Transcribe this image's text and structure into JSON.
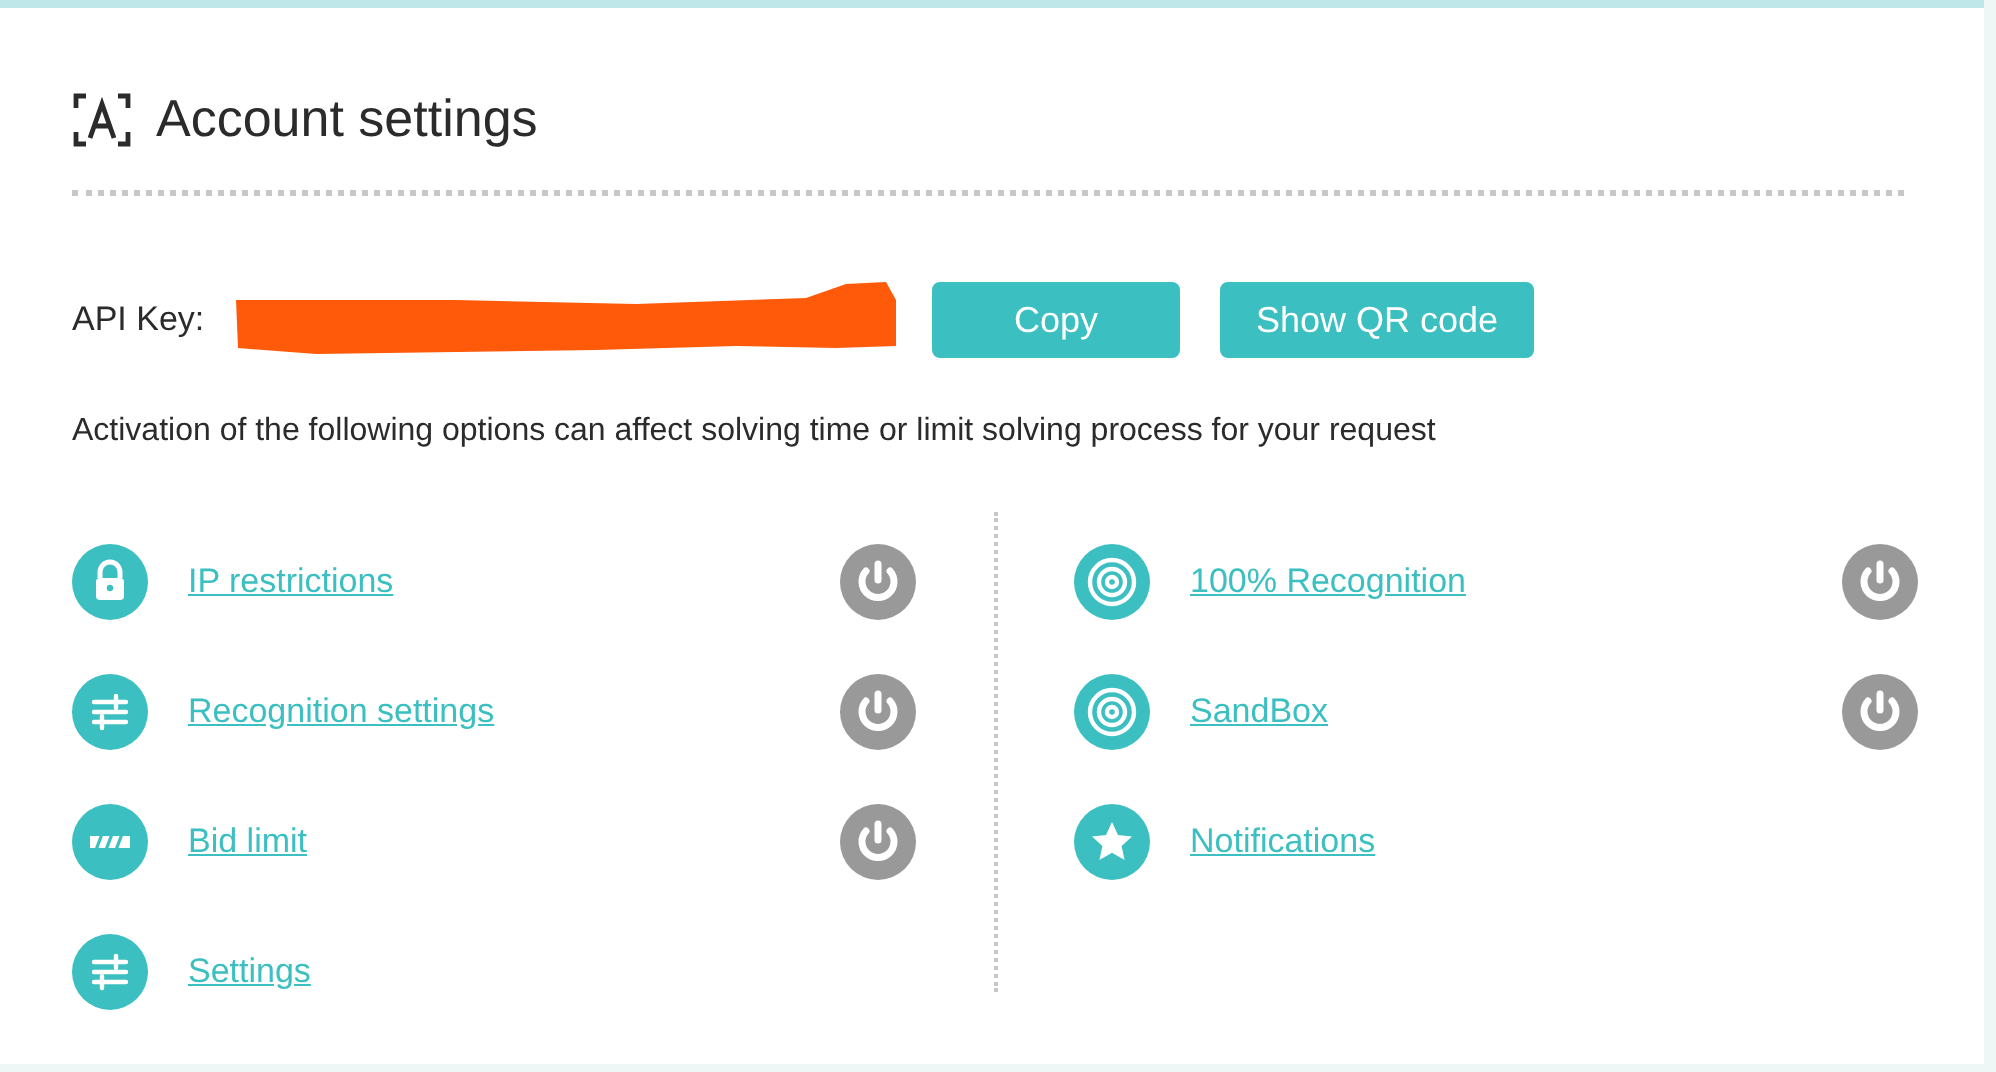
{
  "title": "Account settings",
  "api_key": {
    "label": "API Key:",
    "redacted": true
  },
  "buttons": [
    "Copy",
    "Show QR code"
  ],
  "notice": "Activation of the following options can affect solving time or limit solving process for your request",
  "columns": [
    {
      "options": [
        {
          "kind": "lock",
          "label": "IP restrictions",
          "toggle": {
            "on": false
          }
        },
        {
          "kind": "sliders",
          "label": "Recognition settings",
          "toggle": {
            "on": false
          }
        },
        {
          "kind": "stripes",
          "label": "Bid limit",
          "toggle": {
            "on": false
          }
        },
        {
          "kind": "sliders",
          "label": "Settings"
        }
      ]
    },
    {
      "options": [
        {
          "kind": "target",
          "label": "100% Recognition",
          "toggle": {
            "on": false
          }
        },
        {
          "kind": "target",
          "label": "SandBox",
          "toggle": {
            "on": false
          }
        },
        {
          "kind": "star",
          "label": "Notifications"
        }
      ]
    }
  ]
}
